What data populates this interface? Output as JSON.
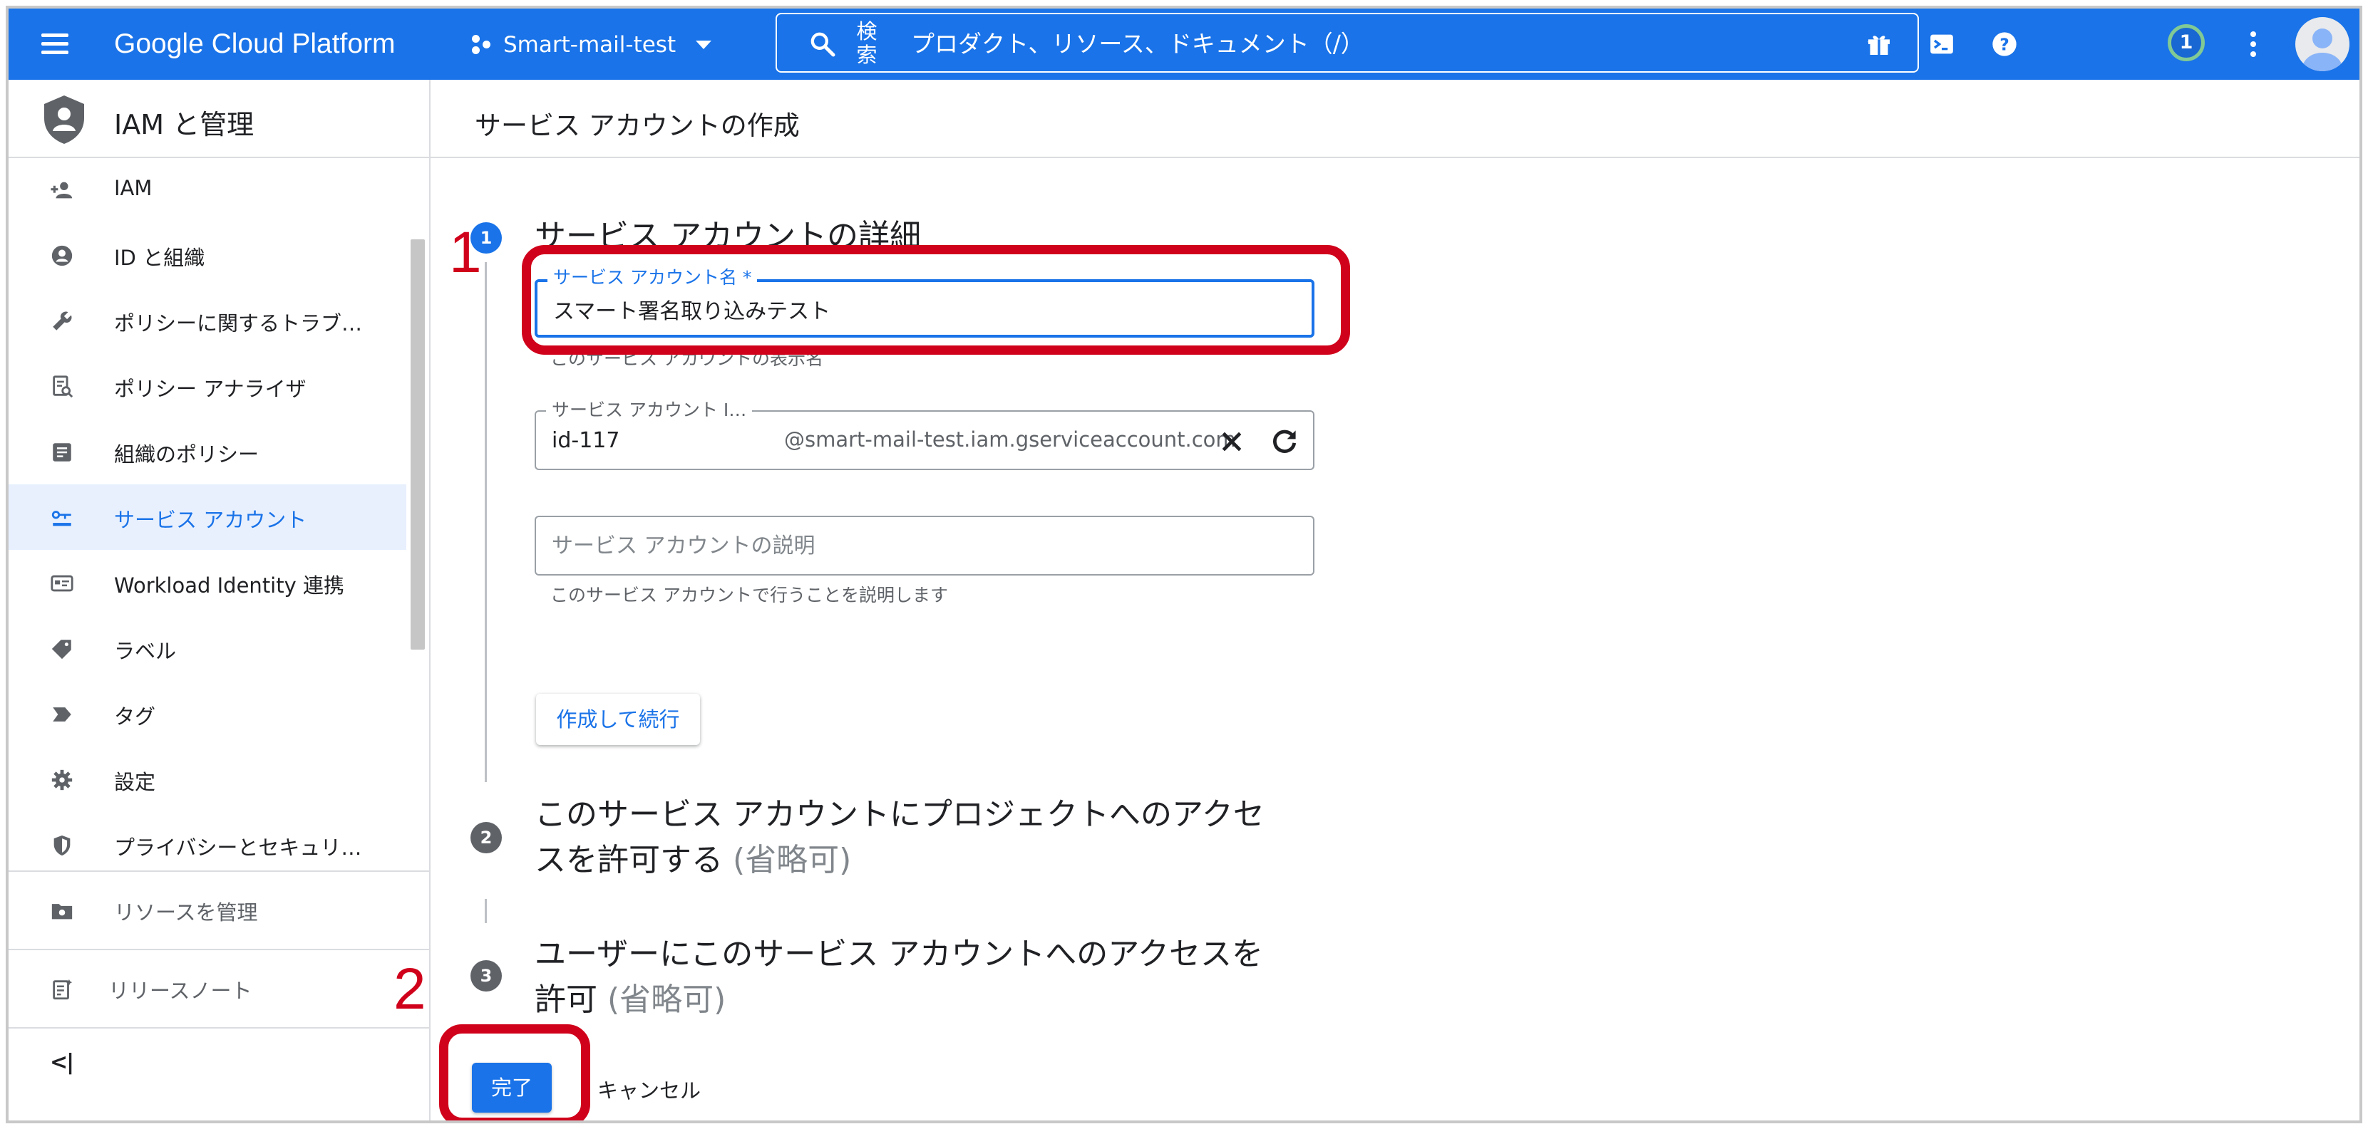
{
  "topbar": {
    "brand": "Google Cloud Platform",
    "project": "Smart-mail-test",
    "search_label": "検索",
    "search_placeholder": "プロダクト、リソース、ドキュメント（/）",
    "notification_count": "1",
    "color": "#1a73e8"
  },
  "sidebar": {
    "title": "IAM と管理",
    "items": [
      {
        "label": "IAM",
        "icon": "person-add-icon"
      },
      {
        "label": "ID と組織",
        "icon": "account-circle-icon"
      },
      {
        "label": "ポリシーに関するトラブ…",
        "icon": "wrench-icon"
      },
      {
        "label": "ポリシー アナライザ",
        "icon": "policy-analyzer-icon"
      },
      {
        "label": "組織のポリシー",
        "icon": "document-icon"
      },
      {
        "label": "サービス アカウント",
        "icon": "service-account-icon",
        "active": true
      },
      {
        "label": "Workload Identity 連携",
        "icon": "id-card-icon"
      },
      {
        "label": "ラベル",
        "icon": "label-icon"
      },
      {
        "label": "タグ",
        "icon": "tag-icon"
      },
      {
        "label": "設定",
        "icon": "gear-icon"
      },
      {
        "label": "プライバシーとセキュリ…",
        "icon": "shield-icon"
      }
    ],
    "manage_resources": "リソースを管理",
    "release_notes": "リリースノート",
    "collapse": "<|"
  },
  "main": {
    "title": "サービス アカウントの作成",
    "step1": {
      "number": "1",
      "title": "サービス アカウントの詳細",
      "name_label": "サービス アカウント名 *",
      "name_value": "スマート署名取り込みテスト",
      "name_hint": "このサービス アカウントの表示名",
      "id_label": "サービス アカウント I…",
      "id_value": "id-117",
      "id_suffix": "@smart-mail-test.iam.gserviceaccount.com",
      "desc_placeholder": "サービス アカウントの説明",
      "desc_hint": "このサービス アカウントで行うことを説明します",
      "create_button": "作成して続行"
    },
    "step2": {
      "number": "2",
      "title_line1": "このサービス アカウントにプロジェクトへのアクセ",
      "title_line2": "スを許可する",
      "optional": "(省略可)"
    },
    "step3": {
      "number": "3",
      "title_line1": "ユーザーにこのサービス アカウントへのアクセスを",
      "title_line2": "許可",
      "optional": "(省略可)"
    },
    "done_button": "完了",
    "cancel_button": "キャンセル"
  },
  "annotations": {
    "label1": "1",
    "label2": "2",
    "color": "#d0021b"
  }
}
